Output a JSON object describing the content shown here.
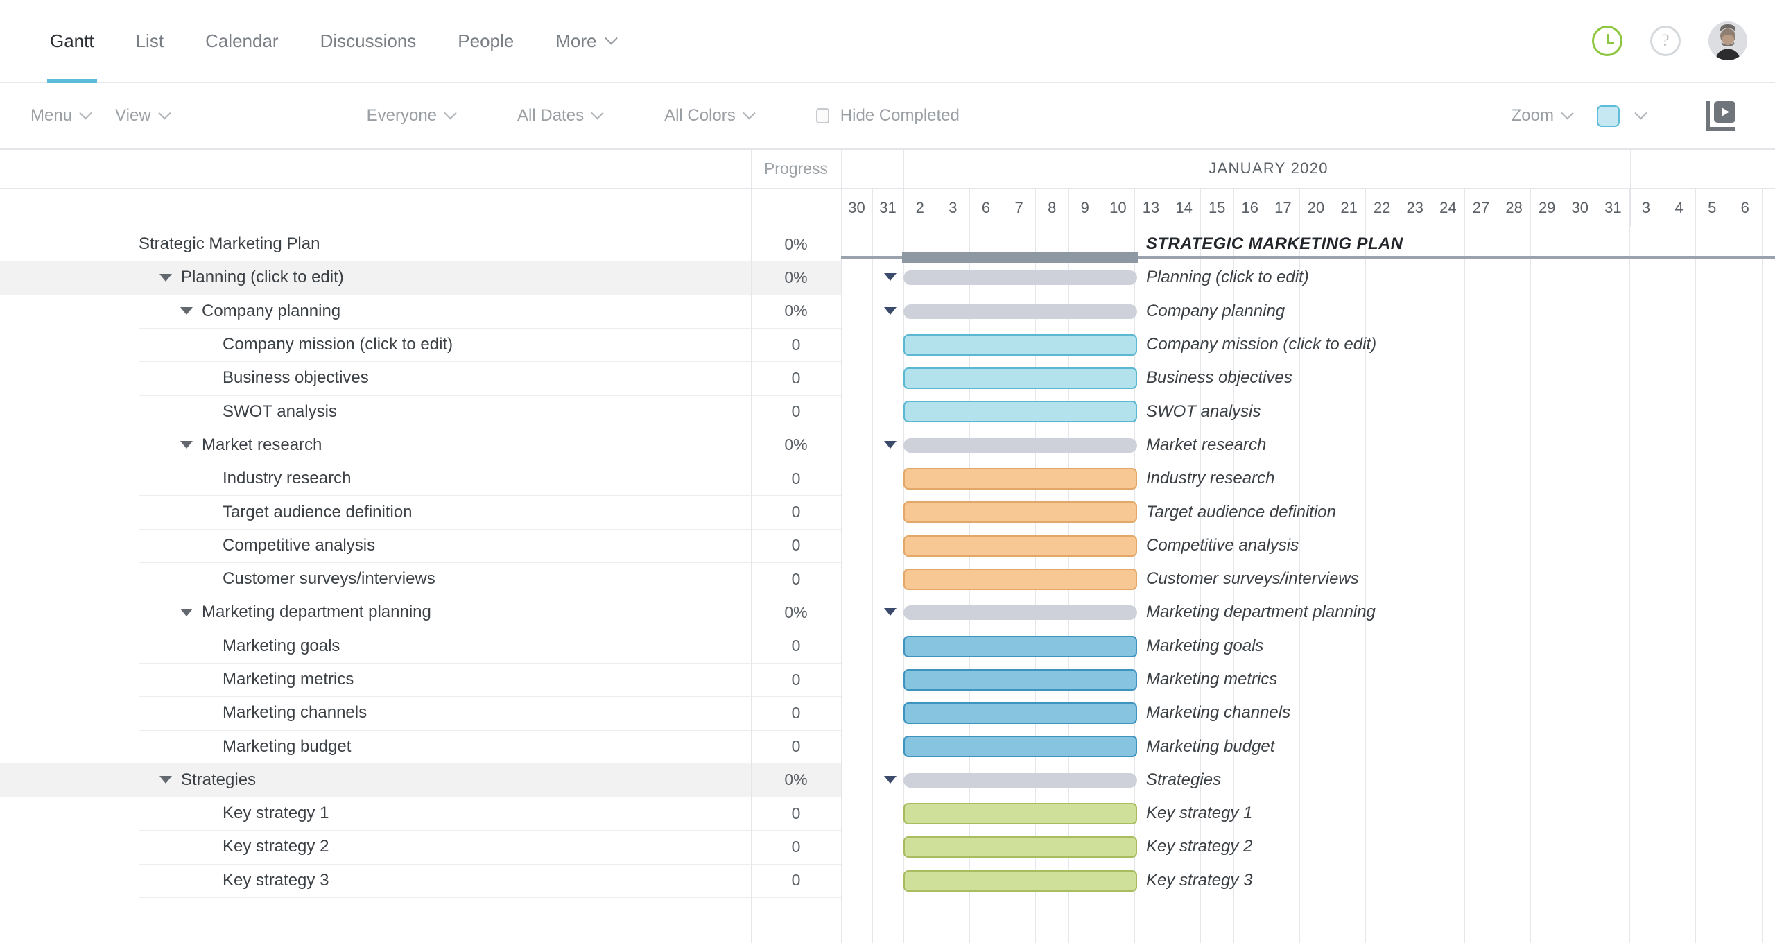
{
  "nav": {
    "tabs": [
      {
        "label": "Gantt",
        "active": true,
        "caret": false
      },
      {
        "label": "List",
        "active": false,
        "caret": false
      },
      {
        "label": "Calendar",
        "active": false,
        "caret": false
      },
      {
        "label": "Discussions",
        "active": false,
        "caret": false
      },
      {
        "label": "People",
        "active": false,
        "caret": false
      },
      {
        "label": "More",
        "active": false,
        "caret": true
      }
    ],
    "time_tracker_icon": "clock-icon",
    "help_label": "?",
    "avatar_label": "user-avatar"
  },
  "toolbar": {
    "menu_label": "Menu",
    "view_label": "View",
    "everyone_label": "Everyone",
    "all_dates_label": "All Dates",
    "all_colors_label": "All Colors",
    "hide_completed_label": "Hide Completed",
    "hide_completed_checked": false,
    "zoom_label": "Zoom",
    "color_swatch": "#c5e8f2",
    "slideshow_icon": "presentation-play-icon"
  },
  "grid": {
    "progress_header": "Progress",
    "month_header": "JANUARY 2020",
    "project_title": "STRATEGIC MARKETING PLAN",
    "days": [
      "30",
      "31",
      "2",
      "3",
      "6",
      "7",
      "8",
      "9",
      "10",
      "13",
      "14",
      "15",
      "16",
      "17",
      "20",
      "21",
      "22",
      "23",
      "24",
      "27",
      "28",
      "29",
      "30",
      "31",
      "3",
      "4",
      "5",
      "6"
    ]
  },
  "colors": {
    "accent": "#5bbcd9",
    "summary_bar": "#cfd1da",
    "project_bar": "#8d98a3",
    "light_blue_fill": "#b3e2ed",
    "light_blue_border": "#5cb8d2",
    "orange_fill": "#f8c894",
    "orange_border": "#e3a869",
    "blue_fill": "#86c4e0",
    "blue_border": "#3f93bf",
    "green_fill": "#cfe09a",
    "green_border": "#a9bd60"
  },
  "tasks": [
    {
      "name": "Strategic Marketing Plan",
      "progress": "0%",
      "indent": 0,
      "expandable": false,
      "shaded": false,
      "bar": "project",
      "bold": true
    },
    {
      "name": "Planning (click to edit)",
      "progress": "0%",
      "indent": 1,
      "expandable": true,
      "shaded": true,
      "bar": "summary"
    },
    {
      "name": "Company planning",
      "progress": "0%",
      "indent": 2,
      "expandable": true,
      "shaded": false,
      "bar": "summary"
    },
    {
      "name": "Company mission (click to edit)",
      "progress": "0",
      "indent": 3,
      "expandable": false,
      "shaded": false,
      "bar": "lightblue"
    },
    {
      "name": "Business objectives",
      "progress": "0",
      "indent": 3,
      "expandable": false,
      "shaded": false,
      "bar": "lightblue"
    },
    {
      "name": "SWOT analysis",
      "progress": "0",
      "indent": 3,
      "expandable": false,
      "shaded": false,
      "bar": "lightblue"
    },
    {
      "name": "Market research",
      "progress": "0%",
      "indent": 2,
      "expandable": true,
      "shaded": false,
      "bar": "summary"
    },
    {
      "name": "Industry research",
      "progress": "0",
      "indent": 3,
      "expandable": false,
      "shaded": false,
      "bar": "orange"
    },
    {
      "name": "Target audience definition",
      "progress": "0",
      "indent": 3,
      "expandable": false,
      "shaded": false,
      "bar": "orange"
    },
    {
      "name": "Competitive analysis",
      "progress": "0",
      "indent": 3,
      "expandable": false,
      "shaded": false,
      "bar": "orange"
    },
    {
      "name": "Customer surveys/interviews",
      "progress": "0",
      "indent": 3,
      "expandable": false,
      "shaded": false,
      "bar": "orange"
    },
    {
      "name": "Marketing department planning",
      "progress": "0%",
      "indent": 2,
      "expandable": true,
      "shaded": false,
      "bar": "summary"
    },
    {
      "name": "Marketing goals",
      "progress": "0",
      "indent": 3,
      "expandable": false,
      "shaded": false,
      "bar": "blue"
    },
    {
      "name": "Marketing metrics",
      "progress": "0",
      "indent": 3,
      "expandable": false,
      "shaded": false,
      "bar": "blue"
    },
    {
      "name": "Marketing channels",
      "progress": "0",
      "indent": 3,
      "expandable": false,
      "shaded": false,
      "bar": "blue"
    },
    {
      "name": "Marketing budget",
      "progress": "0",
      "indent": 3,
      "expandable": false,
      "shaded": false,
      "bar": "blue"
    },
    {
      "name": "Strategies",
      "progress": "0%",
      "indent": 1,
      "expandable": true,
      "shaded": true,
      "bar": "summary"
    },
    {
      "name": "Key strategy 1",
      "progress": "0",
      "indent": 3,
      "expandable": false,
      "shaded": false,
      "bar": "green"
    },
    {
      "name": "Key strategy 2",
      "progress": "0",
      "indent": 3,
      "expandable": false,
      "shaded": false,
      "bar": "green"
    },
    {
      "name": "Key strategy 3",
      "progress": "0",
      "indent": 3,
      "expandable": false,
      "shaded": false,
      "bar": "green"
    }
  ]
}
